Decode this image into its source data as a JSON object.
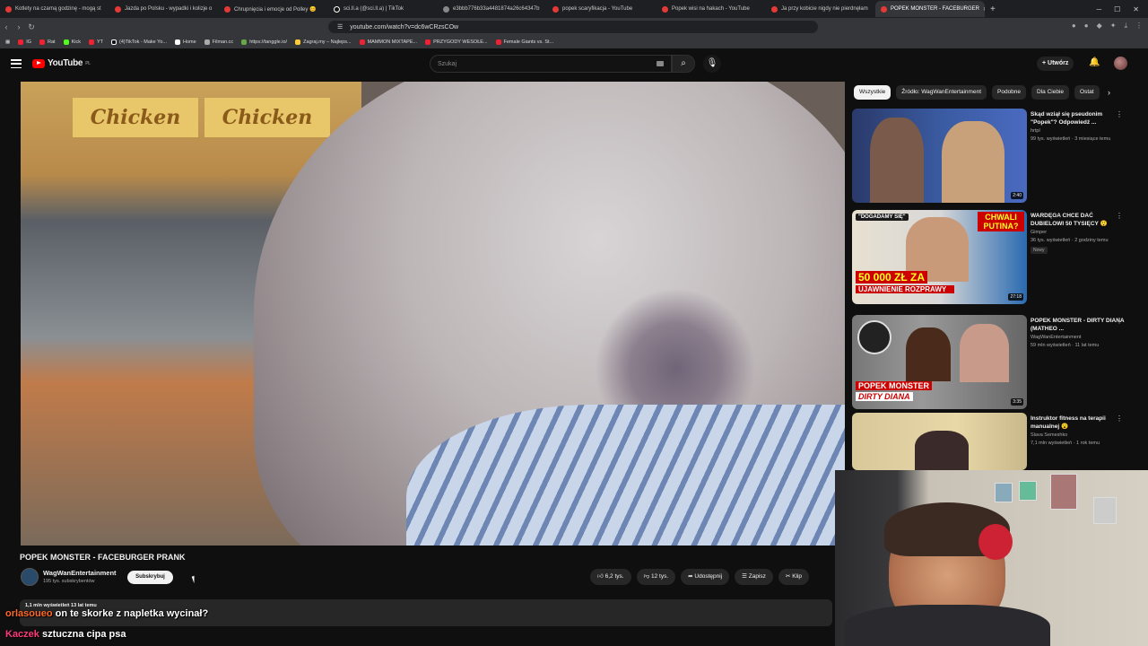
{
  "browser": {
    "tabs": [
      {
        "label": "Kotlety na czarną godzinę - mogą st"
      },
      {
        "label": "Jazda po Polsku - wypadki i kolizje o"
      },
      {
        "label": "Chrupnięcia i emocje od Polley 😊"
      },
      {
        "label": "sci.ll.a (@sci.ll.a) | TikTok"
      },
      {
        "label": "e3bbb776b33a4481874a26c64347b"
      },
      {
        "label": "popek scaryfikacja - YouTube"
      },
      {
        "label": "Popek wisi na hakach - YouTube"
      },
      {
        "label": "Ja przy kobicie nigdy nie pierdnęłam"
      },
      {
        "label": "POPEK MONSTER - FACEBURGER"
      }
    ],
    "url": "youtube.com/watch?v=dc6wCRzsCOw",
    "bookmarks": [
      "IG",
      "Rat",
      "Kick",
      "YT",
      "(4)TikTok - Make Yo...",
      "Home",
      "Filman.cc",
      "https://tanggle.io/",
      "Zagraj.my – Najleps...",
      "MAMMON MIXTAPE...",
      "PRZYGODY WESOŁE...",
      "Female Giants vs. St..."
    ]
  },
  "youtube": {
    "logo_text": "YouTube",
    "logo_region": "PL",
    "search_placeholder": "Szukaj",
    "create_label": "Utwórz"
  },
  "video": {
    "sign_text": "Chicken",
    "title": "POPEK MONSTER - FACEBURGER PRANK",
    "channel": "WagWanEntertainment",
    "subscribers": "195 tys. subskrybentów",
    "subscribe_label": "Subskrybuj",
    "likes": "6,2 tys.",
    "dislikes": "12 tys.",
    "share_label": "Udostępnij",
    "save_label": "Zapisz",
    "clip_label": "Klip",
    "views_line": "1,1 mln wyświetleń  13 lat temu"
  },
  "chips": [
    "Wszystkie",
    "Źródło: WagWanEntertainment",
    "Podobne",
    "Dla Ciebie",
    "Ostat"
  ],
  "recommendations": [
    {
      "title": "Skąd wziął się pseudonim \"Popek\"? Odpowiedź ...",
      "channel": "hrtpl",
      "meta": "99 tys. wyświetleń · 3 miesiące temu",
      "duration": "2:40",
      "new": ""
    },
    {
      "title": "WARDĘGA CHCE DAĆ DUBIELOWI 50 TYSIĘCY 😲",
      "channel": "Gimper",
      "meta": "36 tys. wyświetleń · 2 godziny temu",
      "duration": "27:18",
      "new": "Nowy"
    },
    {
      "title": "POPEK MONSTER - DIRTY DIANA (MATHEO ...",
      "channel": "WagWanEntertainment",
      "meta": "59 mln wyświetleń · 11 lat temu",
      "duration": "3:35",
      "new": ""
    },
    {
      "title": "Instruktor fitness na terapii manualnej 😮",
      "channel": "Slava Semeshko",
      "meta": "7,1 mln wyświetleń · 1 rok temu",
      "duration": "",
      "new": ""
    }
  ],
  "thumb_texts": {
    "t2_top": "\"DOGADAMY SIĘ\"",
    "t2_right": "CHWALI PUTINA?",
    "t2_big": "50 000 ZŁ ZA",
    "t2_big2": "UJAWNIENIE ROZPRAWY",
    "t3_a": "POPEK MONSTER",
    "t3_b": "DIRTY DIANA"
  },
  "chat_overlay": {
    "line1_user": "orlasoueo",
    "line1_text": "on te skorke z napletka wycinał?",
    "line2_user": "Kaczek",
    "line2_text": "sztuczna cipa psa"
  },
  "colors": {
    "accent": "#ff0000",
    "bg": "#0f0f0f"
  }
}
